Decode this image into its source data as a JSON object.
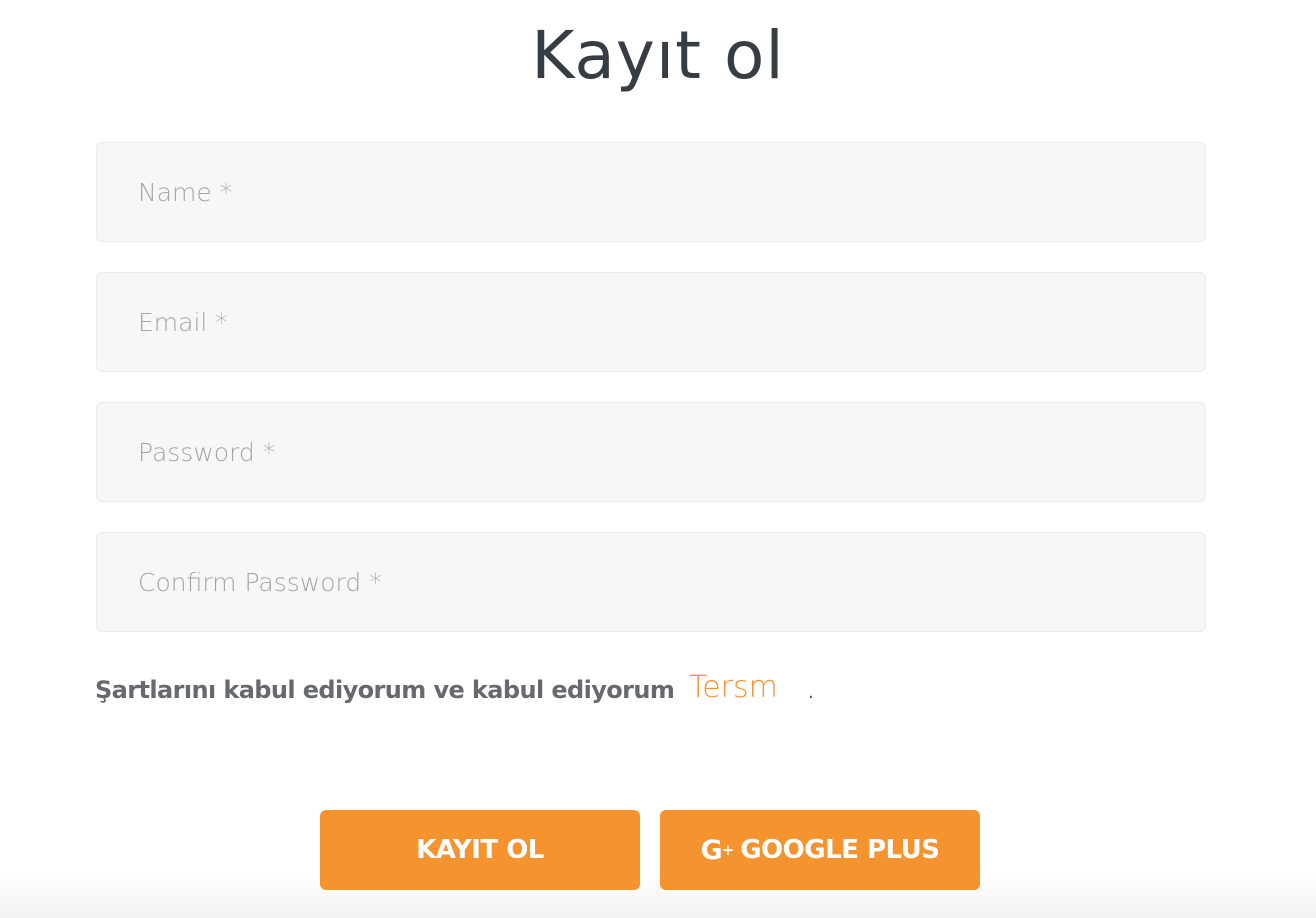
{
  "header": {
    "title": "Kayıt ol"
  },
  "form": {
    "name": {
      "placeholder": "Name *",
      "value": ""
    },
    "email": {
      "placeholder": "Email *",
      "value": ""
    },
    "password": {
      "placeholder": "Password *",
      "value": ""
    },
    "confirm_password": {
      "placeholder": "Confirm Password *",
      "value": ""
    }
  },
  "terms": {
    "text": "Şartlarını kabul ediyorum ve kabul ediyorum",
    "link_label": "Tersm",
    "trailing": "."
  },
  "actions": {
    "register_label": "KAYIT OL",
    "google_label": "GOOGLE PLUS",
    "google_icon": "google-plus-icon"
  },
  "colors": {
    "accent": "#f5932f",
    "title": "#383d44",
    "field_bg": "#f7f7f7",
    "placeholder": "#a4a4a4"
  }
}
